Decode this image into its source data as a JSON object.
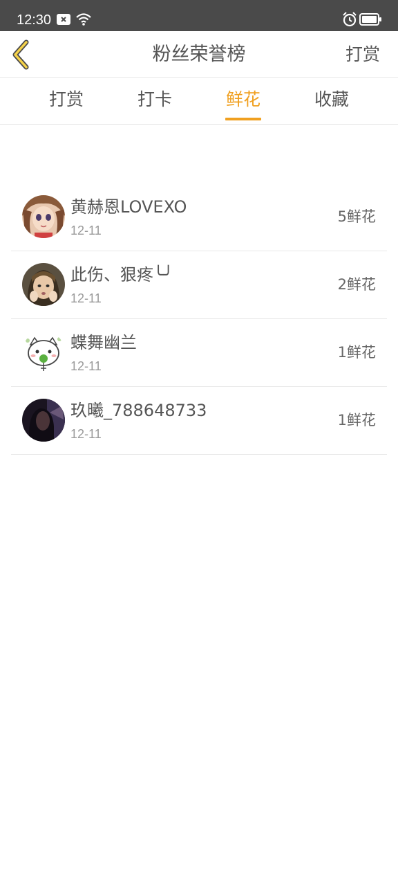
{
  "status_bar": {
    "time": "12:30",
    "icons": [
      "notification-x-icon",
      "wifi-icon",
      "alarm-icon",
      "battery-icon"
    ]
  },
  "nav": {
    "back_icon": "chevron-left-icon",
    "title": "粉丝荣誉榜",
    "action_label": "打赏"
  },
  "tabs": [
    {
      "label": "打赏",
      "active": false
    },
    {
      "label": "打卡",
      "active": false
    },
    {
      "label": "鲜花",
      "active": true
    },
    {
      "label": "收藏",
      "active": false
    }
  ],
  "fans": [
    {
      "name": "黄赫恩LOVEXO",
      "date": "12-11",
      "count": "5鲜花"
    },
    {
      "name": "此伤、狠疼╰╯",
      "date": "12-11",
      "count": "2鲜花"
    },
    {
      "name": "蝶舞幽兰",
      "date": "12-11",
      "count": "1鲜花"
    },
    {
      "name": "玖曦_788648733",
      "date": "12-11",
      "count": "1鲜花"
    }
  ],
  "colors": {
    "accent": "#f0a020",
    "status_bar_bg": "#4a4a4a",
    "text": "#555555",
    "secondary_text": "#9a9a9a"
  }
}
